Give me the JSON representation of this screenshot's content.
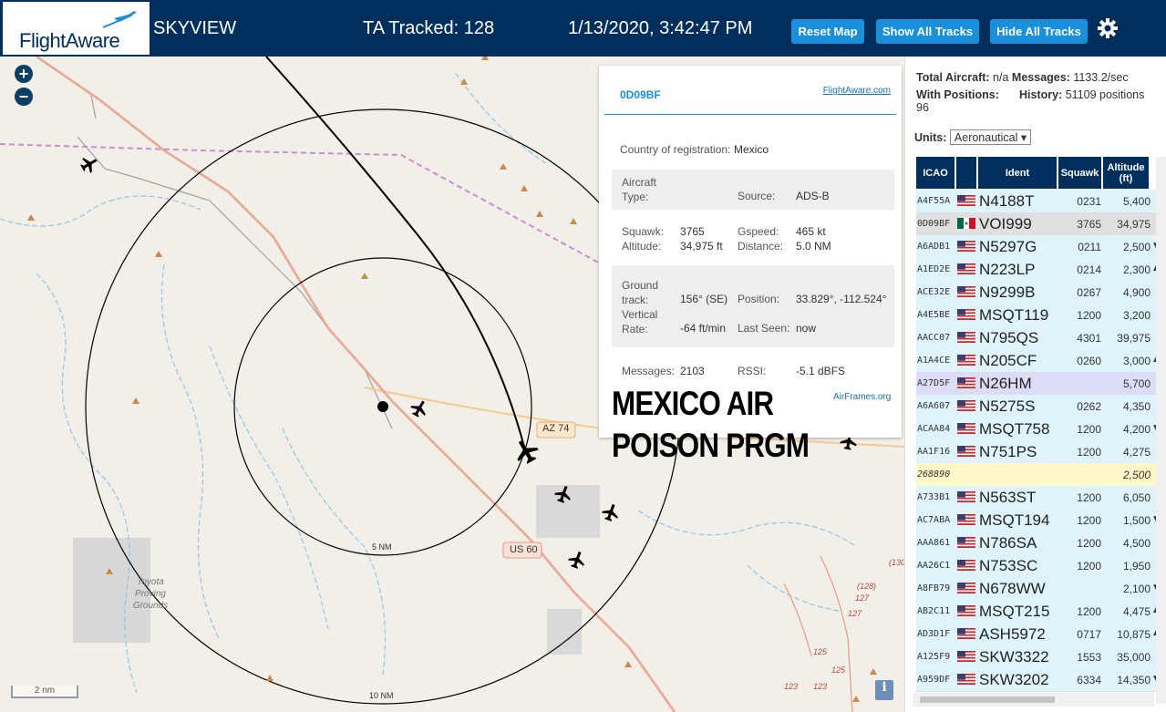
{
  "header": {
    "logo": "FlightAware",
    "title": "SKYVIEW",
    "tracked": "TA Tracked: 128",
    "datetime": "1/13/2020, 3:42:47 PM",
    "buttons": {
      "reset": "Reset Map",
      "show": "Show All Tracks",
      "hide": "Hide All Tracks"
    },
    "settings_icon": "gear-icon"
  },
  "map": {
    "zoom_in": "+",
    "zoom_out": "−",
    "scale": "2 nm",
    "ring_inner": "5 NM",
    "ring_outer": "10 NM",
    "road_az74": "AZ 74",
    "road_us60": "US 60",
    "place": "Toyota Proving Grounds",
    "overlay_line1": "MEXICO AIR",
    "overlay_line2": "POISON PRGM",
    "info_button": "i",
    "road_numbers": [
      "(130",
      "(128)",
      "127",
      "127",
      "125",
      "125",
      "123",
      "123"
    ]
  },
  "popup": {
    "icao": "0D09BF",
    "link": "FlightAware.com",
    "country_label": "Country of registration:",
    "country": "Mexico",
    "aircraft_type_label": "Aircraft Type:",
    "aircraft_type": "",
    "source_label": "Source:",
    "source": "ADS-B",
    "squawk_label": "Squawk:",
    "squawk": "3765",
    "altitude_label": "Altitude:",
    "altitude": "34,975 ft",
    "gspeed_label": "Gspeed:",
    "gspeed": "465 kt",
    "distance_label": "Distance:",
    "distance": "5.0 NM",
    "ground_track_label": "Ground track:",
    "ground_track": "156° (SE)",
    "position_label": "Position:",
    "position": "33.829°, -112.524°",
    "vertical_rate_label": "Vertical Rate:",
    "vertical_rate": "-64 ft/min",
    "last_seen_label": "Last Seen:",
    "last_seen": "now",
    "messages_label": "Messages:",
    "messages": "2103",
    "rssi_label": "RSSI:",
    "rssi": "-5.1 dBFS",
    "airframes": "AirFrames.org"
  },
  "panel": {
    "total_label": "Total Aircraft:",
    "total": "n/a",
    "messages_label": "Messages:",
    "messages": "1133.2/sec",
    "with_pos_label": "With Positions:",
    "with_pos": "96",
    "history_label": "History:",
    "history": "51109 positions",
    "units_label": "Units:",
    "units_value": "Aeronautical",
    "columns": [
      "ICAO",
      "",
      "Ident",
      "Squawk",
      "Altitude (ft)"
    ],
    "rows": [
      {
        "icao": "A4F55A",
        "flag": "us",
        "ident": "N4188T",
        "squawk": "0231",
        "alt": "5,400",
        "arrow": "",
        "style": ""
      },
      {
        "icao": "0D09BF",
        "flag": "mx",
        "ident": "VOI999",
        "squawk": "3765",
        "alt": "34,975",
        "arrow": "",
        "style": "sel"
      },
      {
        "icao": "A6ADB1",
        "flag": "us",
        "ident": "N5297G",
        "squawk": "0211",
        "alt": "2,500",
        "arrow": "▼",
        "style": ""
      },
      {
        "icao": "A1ED2E",
        "flag": "us",
        "ident": "N223LP",
        "squawk": "0214",
        "alt": "2,300",
        "arrow": "▲",
        "style": ""
      },
      {
        "icao": "ACE32E",
        "flag": "us",
        "ident": "N9299B",
        "squawk": "0267",
        "alt": "4,900",
        "arrow": "",
        "style": ""
      },
      {
        "icao": "A4E5BE",
        "flag": "us",
        "ident": "MSQT119",
        "squawk": "1200",
        "alt": "3,200",
        "arrow": "",
        "style": ""
      },
      {
        "icao": "AACC07",
        "flag": "us",
        "ident": "N795QS",
        "squawk": "4301",
        "alt": "39,975",
        "arrow": "",
        "style": ""
      },
      {
        "icao": "A1A4CE",
        "flag": "us",
        "ident": "N205CF",
        "squawk": "0260",
        "alt": "3,000",
        "arrow": "▲",
        "style": ""
      },
      {
        "icao": "A27D5F",
        "flag": "us",
        "ident": "N26HM",
        "squawk": "",
        "alt": "5,700",
        "arrow": "",
        "style": "hl"
      },
      {
        "icao": "A6A607",
        "flag": "us",
        "ident": "N5275S",
        "squawk": "0262",
        "alt": "4,350",
        "arrow": "",
        "style": ""
      },
      {
        "icao": "ACAA84",
        "flag": "us",
        "ident": "MSQT758",
        "squawk": "1200",
        "alt": "4,200",
        "arrow": "▼",
        "style": ""
      },
      {
        "icao": "AA1F16",
        "flag": "us",
        "ident": "N751PS",
        "squawk": "1200",
        "alt": "4,275",
        "arrow": "",
        "style": ""
      },
      {
        "icao": "268890",
        "flag": "",
        "ident": "",
        "squawk": "",
        "alt": "2,500",
        "arrow": "",
        "style": "nopos"
      },
      {
        "icao": "A733B1",
        "flag": "us",
        "ident": "N563ST",
        "squawk": "1200",
        "alt": "6,050",
        "arrow": "",
        "style": ""
      },
      {
        "icao": "AC7ABA",
        "flag": "us",
        "ident": "MSQT194",
        "squawk": "1200",
        "alt": "1,500",
        "arrow": "▼",
        "style": ""
      },
      {
        "icao": "AAA861",
        "flag": "us",
        "ident": "N786SA",
        "squawk": "1200",
        "alt": "4,500",
        "arrow": "",
        "style": ""
      },
      {
        "icao": "AA26C1",
        "flag": "us",
        "ident": "N753SC",
        "squawk": "1200",
        "alt": "1,950",
        "arrow": "",
        "style": ""
      },
      {
        "icao": "A8FB79",
        "flag": "us",
        "ident": "N678WW",
        "squawk": "",
        "alt": "2,100",
        "arrow": "▼",
        "style": ""
      },
      {
        "icao": "AB2C11",
        "flag": "us",
        "ident": "MSQT215",
        "squawk": "1200",
        "alt": "4,475",
        "arrow": "▲",
        "style": ""
      },
      {
        "icao": "AD3D1F",
        "flag": "us",
        "ident": "ASH5972",
        "squawk": "0717",
        "alt": "10,875",
        "arrow": "▲",
        "style": ""
      },
      {
        "icao": "A125F9",
        "flag": "us",
        "ident": "SKW3322",
        "squawk": "1553",
        "alt": "35,000",
        "arrow": "",
        "style": ""
      },
      {
        "icao": "A959DF",
        "flag": "us",
        "ident": "SKW3202",
        "squawk": "6334",
        "alt": "14,350",
        "arrow": "▼",
        "style": ""
      }
    ]
  },
  "colors": {
    "header": "#002f5d",
    "button": "#1a8fdb",
    "row": "#dff3fb",
    "selected": "#e0e0e0",
    "highlight": "#dcdcf7",
    "nopos": "#fff7c8"
  }
}
